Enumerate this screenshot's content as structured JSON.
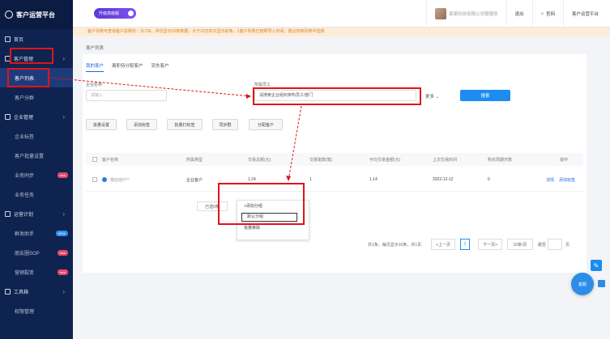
{
  "app": {
    "title": "客户运营平台"
  },
  "sidebar": {
    "items": [
      {
        "label": "首页"
      },
      {
        "label": "客户管理"
      },
      {
        "label": "客户列表"
      },
      {
        "label": "客户分群"
      },
      {
        "label": "企业管理"
      },
      {
        "label": "企业标签"
      },
      {
        "label": "客户批量设置"
      },
      {
        "label": "业务同步",
        "badge": "new"
      },
      {
        "label": "业务任务"
      },
      {
        "label": "运营计划"
      },
      {
        "label": "群发助手",
        "badge": "NEW"
      },
      {
        "label": "朋友圈SOP",
        "badge": "new"
      },
      {
        "label": "营销裂变",
        "badge": "new"
      },
      {
        "label": "工具箱"
      },
      {
        "label": "权限管理"
      }
    ]
  },
  "header": {
    "upgrade": "升级高级版",
    "user": "某某科技有限公司管理员",
    "logout": "退出",
    "home": "官网",
    "account": "客户运营平台"
  },
  "notice": "客户列表可查询客户总数约：11736，共仅显示10条数据，大于10万的只显示前条，1客户列表已按照导入时间，建议将到列表中选择",
  "breadcrumb": "客户列表",
  "tabs": [
    "我的客户",
    "离职待分配客户",
    "流失客户"
  ],
  "filters": {
    "customer_name_label": "企业名称",
    "customer_name_placeholder": "请输入",
    "owner_label": "所属员工",
    "owner_value": "请搜索企业组织架构员工/部门",
    "more": "更多",
    "search": "搜索"
  },
  "actions": [
    "批量设置",
    "添加标签",
    "批量打标签",
    "同步群",
    "分配客户"
  ],
  "table": {
    "headers": [
      "客户名称",
      "所属类型",
      "交易总额(元)",
      "交易笔数(笔)",
      "平均交易金额(元)",
      "上次交易时间",
      "购买周期天数",
      "操作"
    ],
    "rows": [
      {
        "name": "微信用户**",
        "type": "企业客户",
        "total": "1.24",
        "count": "1",
        "avg": "1.14",
        "last": "2022-12-12",
        "cycle": "0",
        "op1": "详情",
        "op2": "添加标签"
      }
    ]
  },
  "batch_select": "已选0条",
  "dropdown": {
    "header": "+添加分组",
    "items": [
      "默认分组",
      "批量移除"
    ]
  },
  "pager": {
    "summary": "共1条，每页显示10条，共1页",
    "prev": "<上一页",
    "page": "1",
    "next": "下一页>",
    "size": "10条/页",
    "goto_label": "跳至",
    "goto_unit": "页"
  },
  "fab": {
    "chat": "客服"
  }
}
